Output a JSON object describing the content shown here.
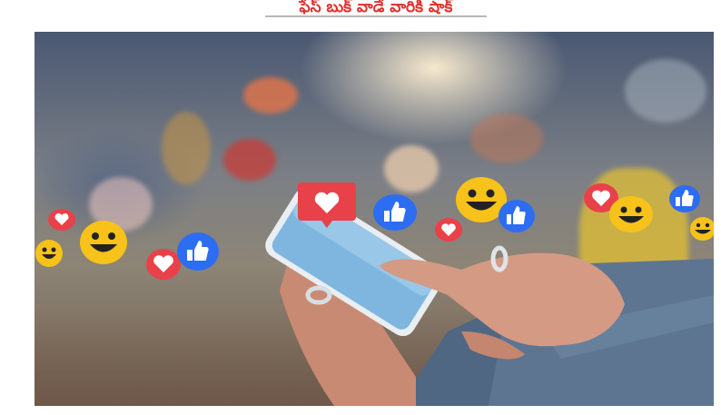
{
  "header": {
    "title": "ఫేస్ బుక్ వాడే వారికి షాక్",
    "rule_color": "#b8b8b8",
    "title_color": "#e0312b"
  },
  "photo": {
    "icons": [
      "heart-icon",
      "like-icon",
      "smiley-icon"
    ],
    "colors": {
      "heart_bg": "#e8414a",
      "like_bg": "#2d6df2",
      "smiley_bg": "#f7c21a"
    }
  }
}
